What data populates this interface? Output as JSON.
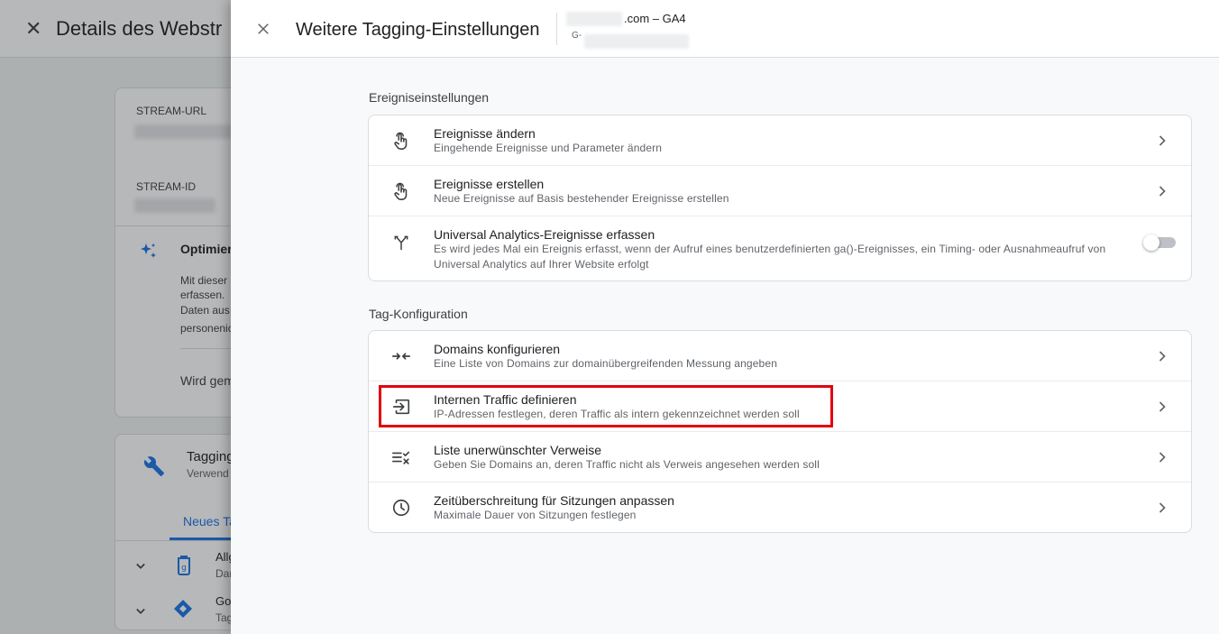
{
  "background": {
    "title": "Details des Webstr",
    "stream_url_label": "STREAM-URL",
    "stream_id_label": "STREAM-ID",
    "optimize_title": "Optimier",
    "optimize_lines": [
      "Mit dieser",
      "erfassen.",
      "Daten aus",
      "personenic"
    ],
    "wird_text": "Wird gem",
    "tagging_title": "Tagging",
    "tagging_sub": "Verwend",
    "tab_label": "Neues Ta",
    "list_items": [
      {
        "title": "Allg",
        "sub": "Dar"
      },
      {
        "title": "Go",
        "sub": "Tag"
      }
    ]
  },
  "drawer": {
    "title": "Weitere Tagging-Einstellungen",
    "stream_name": ".com  – GA4",
    "stream_id_prefix": "G-"
  },
  "sections": [
    {
      "title": "Ereigniseinstellungen",
      "rows": [
        {
          "title": "Ereignisse ändern",
          "subtitle": "Eingehende Ereignisse und Parameter ändern",
          "icon": "touch-icon",
          "control": "chevron"
        },
        {
          "title": "Ereignisse erstellen",
          "subtitle": "Neue Ereignisse auf Basis bestehender Ereignisse erstellen",
          "icon": "touch-icon",
          "control": "chevron"
        },
        {
          "title": "Universal Analytics-Ereignisse erfassen",
          "subtitle": "Es wird jedes Mal ein Ereignis erfasst, wenn der Aufruf eines benutzerdefinierten ga()-Ereignisses, ein Timing- oder Ausnahmeaufruf von Universal Analytics auf Ihrer Website erfolgt",
          "icon": "merge-icon",
          "control": "toggle",
          "toggle_on": false
        }
      ]
    },
    {
      "title": "Tag-Konfiguration",
      "rows": [
        {
          "title": "Domains konfigurieren",
          "subtitle": "Eine Liste von Domains zur domainübergreifenden Messung angeben",
          "icon": "compress-arrows-icon",
          "control": "chevron"
        },
        {
          "title": "Internen Traffic definieren",
          "subtitle": "IP-Adressen festlegen, deren Traffic als intern gekennzeichnet werden soll",
          "icon": "input-icon",
          "control": "chevron"
        },
        {
          "title": "Liste unerwünschter Verweise",
          "subtitle": "Geben Sie Domains an, deren Traffic nicht als Verweis angesehen werden soll",
          "icon": "list-x-icon",
          "control": "chevron"
        },
        {
          "title": "Zeitüberschreitung für Sitzungen anpassen",
          "subtitle": "Maximale Dauer von Sitzungen festlegen",
          "icon": "clock-icon",
          "control": "chevron"
        }
      ]
    }
  ],
  "colors": {
    "accent": "#1a73e8",
    "highlight": "#e2000f"
  }
}
